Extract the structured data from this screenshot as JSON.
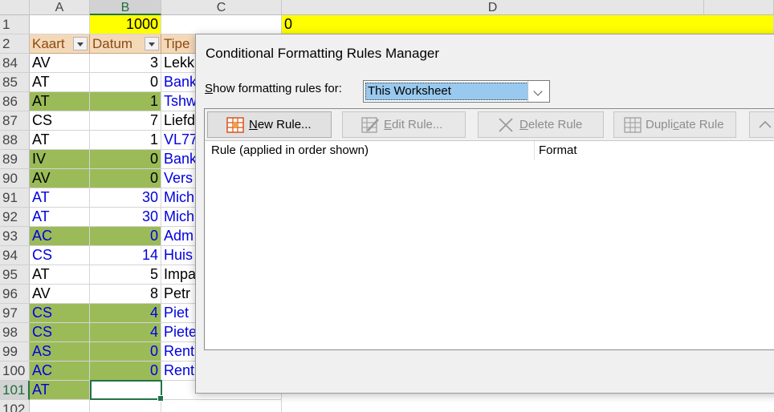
{
  "sheet": {
    "columns": [
      "A",
      "B",
      "C",
      "D"
    ],
    "selected_column": "B",
    "row1": {
      "row_number": "1",
      "b_value": "1000",
      "d_value": "0"
    },
    "row2": {
      "row_number": "2",
      "headers": [
        "Kaart",
        "Datum",
        "Tipe"
      ]
    },
    "rows": [
      {
        "num": "84",
        "a": "AV",
        "b": "3",
        "c": "Lekk",
        "green": false,
        "blue": false
      },
      {
        "num": "85",
        "a": "AT",
        "b": "0",
        "c": "Bank",
        "green": false,
        "blue": true,
        "blue_ab": false
      },
      {
        "num": "86",
        "a": "AT",
        "b": "1",
        "c": "Tshw",
        "green": true,
        "blue": true,
        "blue_ab": false
      },
      {
        "num": "87",
        "a": "CS",
        "b": "7",
        "c": "Liefd",
        "green": false,
        "blue": false
      },
      {
        "num": "88",
        "a": "AT",
        "b": "1",
        "c": "VL77",
        "green": false,
        "blue": true,
        "blue_ab": false
      },
      {
        "num": "89",
        "a": "IV",
        "b": "0",
        "c": "Bank",
        "green": true,
        "blue": true,
        "blue_ab": false
      },
      {
        "num": "90",
        "a": "AV",
        "b": "0",
        "c": "Vers",
        "green": true,
        "blue": true,
        "blue_ab": false
      },
      {
        "num": "91",
        "a": "AT",
        "b": "30",
        "c": "Mich",
        "green": false,
        "blue": true,
        "blue_ab": true
      },
      {
        "num": "92",
        "a": "AT",
        "b": "30",
        "c": "Mich",
        "green": false,
        "blue": true,
        "blue_ab": true
      },
      {
        "num": "93",
        "a": "AC",
        "b": "0",
        "c": "Adm",
        "green": true,
        "blue": true,
        "blue_ab": true
      },
      {
        "num": "94",
        "a": "CS",
        "b": "14",
        "c": "Huis",
        "green": false,
        "blue": true,
        "blue_ab": true
      },
      {
        "num": "95",
        "a": "AT",
        "b": "5",
        "c": "Impa",
        "green": false,
        "blue": false
      },
      {
        "num": "96",
        "a": "AV",
        "b": "8",
        "c": "Petr",
        "green": false,
        "blue": false
      },
      {
        "num": "97",
        "a": "CS",
        "b": "4",
        "c": "Piet",
        "green": true,
        "blue": true,
        "blue_ab": true
      },
      {
        "num": "98",
        "a": "CS",
        "b": "4",
        "c": "Piete",
        "green": true,
        "blue": true,
        "blue_ab": true
      },
      {
        "num": "99",
        "a": "AS",
        "b": "0",
        "c": "Rent",
        "green": true,
        "blue": true,
        "blue_ab": true
      },
      {
        "num": "100",
        "a": "AC",
        "b": "0",
        "c": "Rent",
        "green": true,
        "blue": true,
        "blue_ab": true
      },
      {
        "num": "101",
        "a": "AT",
        "b": "",
        "c": "",
        "green": true,
        "blue": true,
        "blue_ab": true,
        "active": true
      },
      {
        "num": "102",
        "a": "",
        "b": "",
        "c": "",
        "green": false,
        "blue": false
      }
    ],
    "colors": {
      "green_fill": "#9bbb59",
      "blue_text": "#0000e0",
      "yellow_fill": "#ffff00",
      "header_fill": "#f4d9b9",
      "selection": "#217346"
    }
  },
  "dialog": {
    "title": "Conditional Formatting Rules Manager",
    "show_label_pre": "",
    "show_label_mnemonic": "S",
    "show_label_post": "how formatting rules for:",
    "scope_value": "This Worksheet",
    "buttons": {
      "new_rule": {
        "mn": "N",
        "rest": "ew Rule..."
      },
      "edit_rule": {
        "mn": "E",
        "rest": "dit Rule..."
      },
      "delete_rule": {
        "mn": "D",
        "rest": "elete Rule"
      },
      "duplicate_rule": {
        "pre": "Dupli",
        "mn": "c",
        "rest": "ate Rule"
      }
    },
    "columns": {
      "rule": "Rule (applied in order shown)",
      "format": "Format"
    }
  }
}
